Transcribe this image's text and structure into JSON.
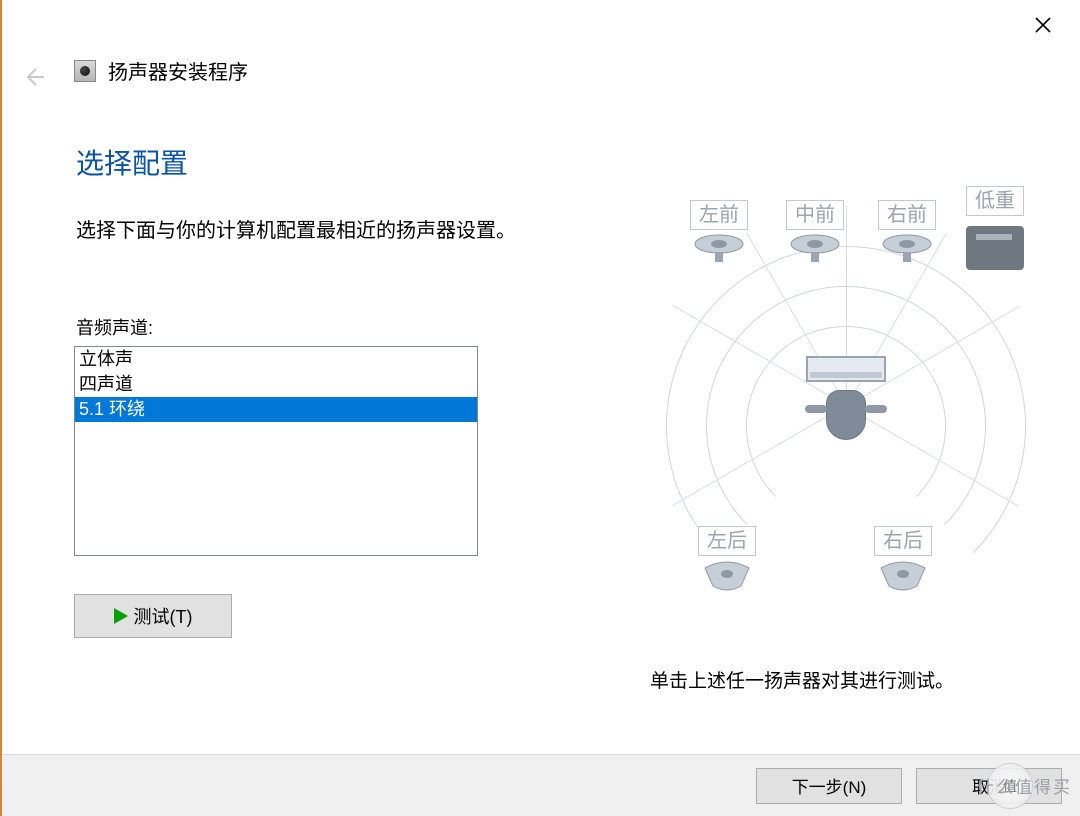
{
  "header": {
    "title": "扬声器安装程序"
  },
  "page": {
    "heading": "选择配置",
    "description": "选择下面与你的计算机配置最相近的扬声器设置。",
    "channels_label": "音频声道:",
    "options": [
      "立体声",
      "四声道",
      "5.1 环绕"
    ],
    "selected_index": 2,
    "test_button": "测试(T)",
    "diagram_hint": "单击上述任一扬声器对其进行测试。"
  },
  "speakers": {
    "left_front": "左前",
    "center_front": "中前",
    "right_front": "右前",
    "subwoofer": "低重",
    "left_rear": "左后",
    "right_rear": "右后"
  },
  "footer": {
    "next": "下一步(N)",
    "cancel": "取消"
  },
  "watermark": {
    "badge": "值",
    "text": "什么值得买"
  }
}
